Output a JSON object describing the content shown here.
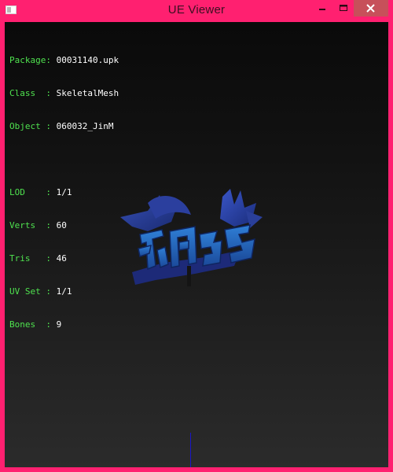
{
  "window": {
    "title": "UE Viewer",
    "icons": {
      "app": "app-window-icon",
      "minimize": "minimize-icon",
      "maximize": "maximize-icon",
      "close": "close-icon"
    },
    "colors": {
      "frame": "#ff2070",
      "close_button": "#c7505a"
    }
  },
  "info": {
    "package_label": "Package:",
    "package_value": "00031140.upk",
    "class_label": "Class  :",
    "class_value": "SkeletalMesh",
    "object_label": "Object :",
    "object_value": "060032_JinM",
    "lod_label": "LOD    :",
    "lod_value": "1/1",
    "verts_label": "Verts  :",
    "verts_value": "60",
    "tris_label": "Tris   :",
    "tris_value": "46",
    "uvset_label": "UV Set :",
    "uvset_value": "1/1",
    "bones_label": "Bones  :",
    "bones_value": "9",
    "colors": {
      "label": "#4fe24f",
      "value": "#ffffff"
    }
  },
  "viewport": {
    "mesh_icon": "calligraphy-logo-mesh",
    "axis_color": "#1a17c8"
  }
}
